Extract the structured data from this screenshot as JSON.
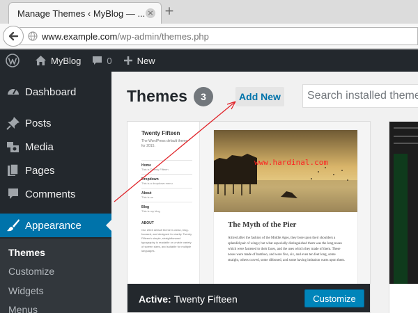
{
  "browser": {
    "tab_title": "Manage Themes ‹ MyBlog — ...",
    "tab_close": "×",
    "new_tab": "+",
    "url_host": "www.example.com",
    "url_path": "/wp-admin/themes.php"
  },
  "adminbar": {
    "site_name": "MyBlog",
    "comments_count": "0",
    "new_label": "New"
  },
  "sidebar": {
    "items": [
      {
        "label": "Dashboard",
        "icon": "dashboard-icon"
      },
      {
        "label": "Posts",
        "icon": "pin-icon"
      },
      {
        "label": "Media",
        "icon": "media-icon"
      },
      {
        "label": "Pages",
        "icon": "pages-icon"
      },
      {
        "label": "Comments",
        "icon": "comment-icon"
      },
      {
        "label": "Appearance",
        "icon": "brush-icon",
        "active": true
      }
    ],
    "submenu": [
      "Themes",
      "Customize",
      "Widgets",
      "Menus"
    ]
  },
  "main": {
    "title": "Themes",
    "count": "3",
    "add_new": "Add New",
    "search_placeholder": "Search installed themes..."
  },
  "theme_card": {
    "active_label": "Active:",
    "theme_name": "Twenty Fifteen",
    "customize_label": "Customize",
    "preview": {
      "site_title": "Twenty Fifteen",
      "tagline": "The WordPress default theme for 2015.",
      "nav_home": "Home",
      "nav_home_sub": "This is Twenty Fifteen",
      "nav_dropdown": "Dropdown",
      "nav_dropdown_sub": "This is a dropdown menu",
      "nav_about": "About",
      "nav_about_sub": "This is us",
      "nav_blog": "Blog",
      "nav_blog_sub": "This is my blog",
      "about_heading": "ABOUT",
      "about_text": "Our 2015 default theme is clean, blog-focused, and designed for clarity. Twenty Fifteen's simple, straightforward typography is readable on a wide variety of screen sizes, and suitable for multiple languages.",
      "watermark": "www.hardinal.com",
      "post_title": "The Myth of the Pier",
      "post_text": "Attired after the fashion of the Middle Ages, they bore upon their shoulders a splendid pair of wings; but what especially distinguished them was the long noses which were fastened to their faces, and the uses which they made of them. These noses were made of bamboo, and were five, six, and even ten feet long, some straight, others curved, some ribboned, and some having imitation warts upon them."
    }
  },
  "colors": {
    "adminbar": "#23282d",
    "accent": "#0073aa",
    "button": "#0085ba",
    "annotation_arrow": "#e0242a"
  }
}
